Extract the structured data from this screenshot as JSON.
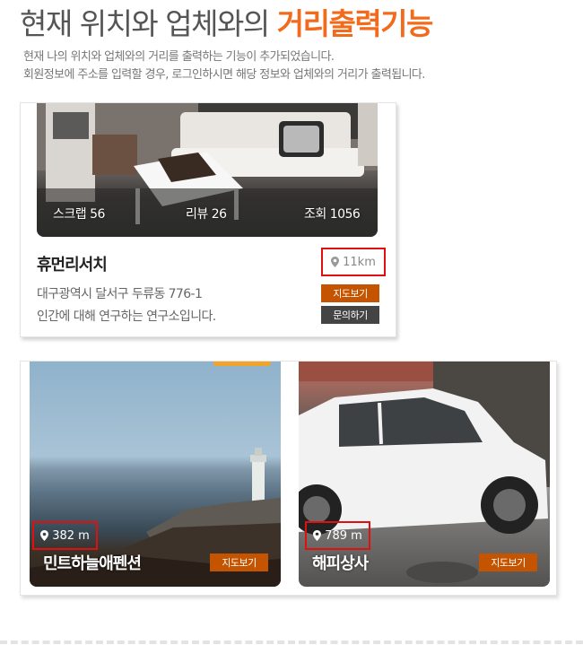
{
  "header": {
    "title_normal": "현재 위치와 업체와의",
    "title_highlight": "거리출력기능",
    "desc_line1": "현재 나의 위치와 업체와의 거리를 출력하는 기능이 추가되었습니다.",
    "desc_line2": "회원정보에 주소를 입력할 경우, 로그인하시면 해당 정보와 업체와의 거리가 출력됩니다."
  },
  "card1": {
    "scrap": "스크랩 56",
    "review": "리뷰 26",
    "views": "조회 1056",
    "name": "휴먼리서치",
    "distance": "11km",
    "address": "대구광역시 달서구 두류동 776-1",
    "description": "인간에 대해 연구하는 연구소입니다.",
    "map_button": "지도보기",
    "inquiry_button": "문의하기"
  },
  "card2": {
    "items": [
      {
        "distance": "382 m",
        "name": "민트하늘애펜션",
        "map_button": "지도보기"
      },
      {
        "distance": "789 m",
        "name": "해피상사",
        "map_button": "지도보기"
      }
    ]
  },
  "colors": {
    "accent": "#f26b1d",
    "button_orange": "#c45400",
    "button_dark": "#444444",
    "highlight_border": "#e01010"
  },
  "icons": {
    "distance": "map-pin-icon"
  }
}
